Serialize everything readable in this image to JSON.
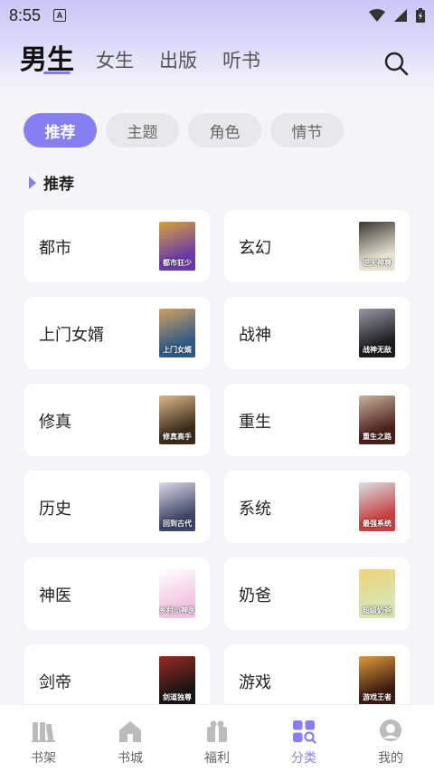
{
  "status_bar": {
    "time": "8:55",
    "notification_badge": "A"
  },
  "top_tabs": [
    {
      "label": "男生",
      "active": true
    },
    {
      "label": "女生",
      "active": false
    },
    {
      "label": "出版",
      "active": false
    },
    {
      "label": "听书",
      "active": false
    }
  ],
  "filters": [
    {
      "label": "推荐",
      "active": true
    },
    {
      "label": "主题",
      "active": false
    },
    {
      "label": "角色",
      "active": false
    },
    {
      "label": "情节",
      "active": false
    }
  ],
  "section": {
    "title": "推荐"
  },
  "categories": [
    {
      "label": "都市",
      "cover_colors": [
        "#6a3aa8",
        "#d8a23a"
      ],
      "cover_text": "都市狂少"
    },
    {
      "label": "玄幻",
      "cover_colors": [
        "#e8e2d2",
        "#3a3630"
      ],
      "cover_text": "逆天神尊"
    },
    {
      "label": "上门女婿",
      "cover_colors": [
        "#2f5a86",
        "#d0a060"
      ],
      "cover_text": "上门女婿"
    },
    {
      "label": "战神",
      "cover_colors": [
        "#1c1c20",
        "#9a9aa6"
      ],
      "cover_text": "战神无敌"
    },
    {
      "label": "修真",
      "cover_colors": [
        "#3b2a18",
        "#d9b98a"
      ],
      "cover_text": "修真高手"
    },
    {
      "label": "重生",
      "cover_colors": [
        "#4a1f1a",
        "#c9b39a"
      ],
      "cover_text": "重生之路"
    },
    {
      "label": "历史",
      "cover_colors": [
        "#3c4666",
        "#ddd8ea"
      ],
      "cover_text": "回到古代"
    },
    {
      "label": "系统",
      "cover_colors": [
        "#c73f3f",
        "#d9e0e6"
      ],
      "cover_text": "最强系统"
    },
    {
      "label": "神医",
      "cover_colors": [
        "#f2c6e2",
        "#ffffff"
      ],
      "cover_text": "乡村小神医"
    },
    {
      "label": "奶爸",
      "cover_colors": [
        "#d8e6b2",
        "#f0d078"
      ],
      "cover_text": "超级奶爸"
    },
    {
      "label": "剑帝",
      "cover_colors": [
        "#1a1414",
        "#9a2a22"
      ],
      "cover_text": "剑道独尊"
    },
    {
      "label": "游戏",
      "cover_colors": [
        "#3a1a10",
        "#e09a3a"
      ],
      "cover_text": "游戏王者"
    }
  ],
  "bottom_nav": [
    {
      "label": "书架",
      "icon": "bookshelf-icon",
      "active": false
    },
    {
      "label": "书城",
      "icon": "bookstore-icon",
      "active": false
    },
    {
      "label": "福利",
      "icon": "gift-icon",
      "active": false
    },
    {
      "label": "分类",
      "icon": "category-icon",
      "active": true
    },
    {
      "label": "我的",
      "icon": "profile-icon",
      "active": false
    }
  ],
  "colors": {
    "accent": "#857ff2",
    "pill_inactive": "#e8e8ea",
    "card_bg": "#ffffff",
    "page_bg": "#f5f5f7"
  }
}
